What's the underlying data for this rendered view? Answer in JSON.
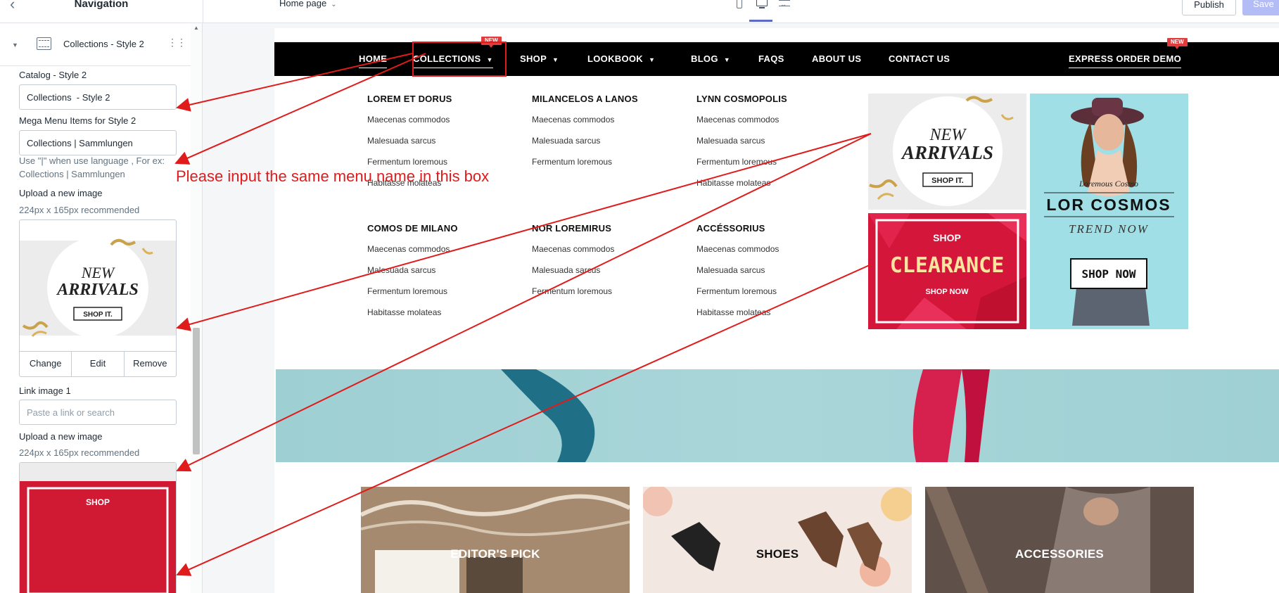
{
  "topbar": {
    "title": "Navigation",
    "page_select": "Home page",
    "publish_label": "Publish",
    "save_label": "Save"
  },
  "sidebar": {
    "section_name": "Collections - Style 2",
    "fields": {
      "catalog_label": "Catalog - Style 2",
      "catalog_value": "Collections  - Style 2",
      "mega_menu_label": "Mega Menu Items for Style 2",
      "mega_menu_value": "Collections | Sammlungen",
      "mega_menu_help_1": "Use \"|\" when use language , For ex:",
      "mega_menu_help_2": "Collections | Sammlungen",
      "upload_1_label": "Upload a new image",
      "upload_1_help": "224px x 165px recommended",
      "image_actions": [
        "Change",
        "Edit",
        "Remove"
      ],
      "link_1_label": "Link image 1",
      "link_1_placeholder": "Paste a link or search",
      "upload_2_label": "Upload a new image",
      "upload_2_help": "224px x 165px recommended"
    }
  },
  "preview": {
    "nav": [
      {
        "label": "HOME"
      },
      {
        "label": "COLLECTIONS"
      },
      {
        "label": "SHOP"
      },
      {
        "label": "LOOKBOOK"
      },
      {
        "label": "BLOG"
      },
      {
        "label": "FAQS"
      },
      {
        "label": "ABOUT US"
      },
      {
        "label": "CONTACT US"
      },
      {
        "label": "EXPRESS ORDER DEMO"
      }
    ],
    "badge_new": "NEW",
    "mega_columns": [
      {
        "heading": "LOREM ET DORUS",
        "links": [
          "Maecenas commodos",
          "Malesuada sarcus",
          "Fermentum loremous",
          "Habitasse molateas"
        ]
      },
      {
        "heading": "MILANCELOS A LANOS",
        "links": [
          "Maecenas commodos",
          "Malesuada sarcus",
          "Fermentum loremous"
        ]
      },
      {
        "heading": "LYNN COSMOPOLIS",
        "links": [
          "Maecenas commodos",
          "Malesuada sarcus",
          "Fermentum loremous",
          "Habitasse molateas"
        ]
      },
      {
        "heading": "COMOS DE MILANO",
        "links": [
          "Maecenas commodos",
          "Malesuada sarcus",
          "Fermentum loremous",
          "Habitasse molateas"
        ]
      },
      {
        "heading": "NOR LOREMIRUS",
        "links": [
          "Maecenas commodos",
          "Malesuada sarcus",
          "Fermentum loremous"
        ]
      },
      {
        "heading": "ACCÉSSORIUS",
        "links": [
          "Maecenas commodos",
          "Malesuada sarcus",
          "Fermentum loremous",
          "Habitasse molateas"
        ]
      }
    ],
    "banners": {
      "new_arrivals_line1": "NEW",
      "new_arrivals_line2": "ARRIVALS",
      "shop_it": "SHOP IT.",
      "clearance_top": "SHOP",
      "clearance_main": "CLEARANCE",
      "clearance_bottom": "SHOP NOW",
      "cosmos_script": "Loremous Cosmo",
      "cosmos_title": "LOR COSMOS",
      "cosmos_sub": "TREND NOW",
      "cosmos_button": "SHOP NOW"
    },
    "tiles": [
      "EDITOR'S PICK",
      "SHOES",
      "ACCESSORIES"
    ]
  },
  "annotation": {
    "text": "Please input the same menu name in this box",
    "color": "#e01b1b"
  }
}
